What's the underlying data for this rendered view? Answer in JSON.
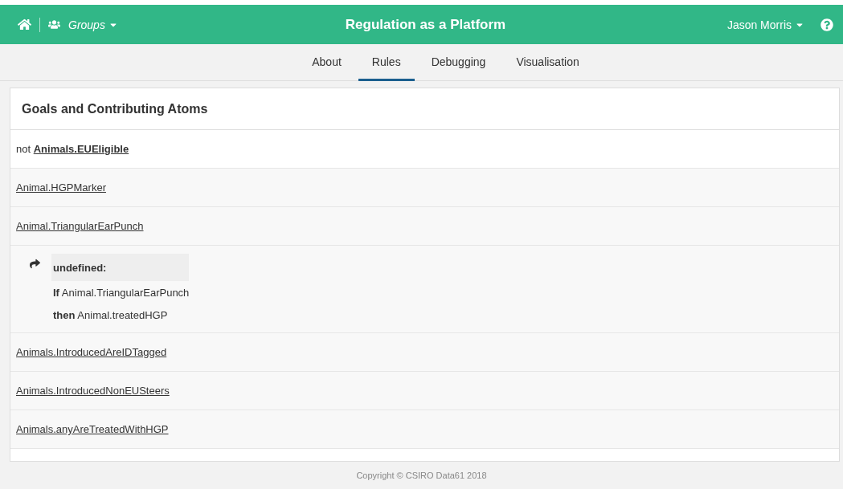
{
  "navbar": {
    "groups": "Groups",
    "title": "Regulation as a Platform",
    "user": "Jason Morris"
  },
  "tabs": [
    {
      "label": "About",
      "selected": false
    },
    {
      "label": "Rules",
      "selected": true
    },
    {
      "label": "Debugging",
      "selected": false
    },
    {
      "label": "Visualisation",
      "selected": false
    }
  ],
  "panel": {
    "title": "Goals and Contributing Atoms",
    "rows": [
      {
        "kind": "negated",
        "prefix": "not",
        "link": "Animals.EUEligible"
      },
      {
        "kind": "atom",
        "link": "Animal.HGPMarker"
      },
      {
        "kind": "atom",
        "link": "Animal.TriangularEarPunch"
      },
      {
        "kind": "rule",
        "heading": "undefined:",
        "lines": [
          {
            "keyword": "If",
            "text": "Animal.TriangularEarPunch"
          },
          {
            "keyword": "then",
            "text": "Animal.treatedHGP"
          }
        ]
      },
      {
        "kind": "atom",
        "link": "Animals.IntroducedAreIDTagged"
      },
      {
        "kind": "atom",
        "link": "Animals.IntroducedNonEUSteers"
      },
      {
        "kind": "atom",
        "link": "Animals.anyAreTreatedWithHGP"
      }
    ]
  },
  "footer": "Copyright © CSIRO Data61 2018"
}
